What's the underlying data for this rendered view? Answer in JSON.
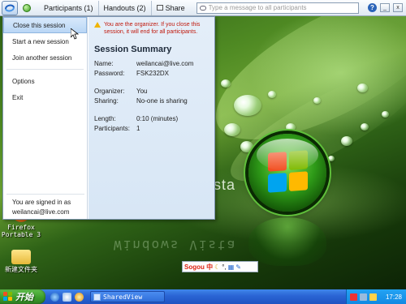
{
  "toolbar": {
    "participants_label": "Participants (1)",
    "handouts_label": "Handouts (2)",
    "share_label": "Share",
    "search_placeholder": "Type a message to all participants",
    "help_label": "?",
    "minimize_label": "_",
    "close_label": "x"
  },
  "menu": {
    "items": [
      {
        "label": "Close this session"
      },
      {
        "label": "Start a new session"
      },
      {
        "label": "Join another session"
      },
      {
        "label": "Options"
      },
      {
        "label": "Exit"
      }
    ],
    "signed_in_line1": "You are signed in as",
    "signed_in_line2": "weilancai@live.com"
  },
  "summary": {
    "warning": "You are the organizer. If you close this session, it will end for all participants.",
    "title": "Session Summary",
    "name_label": "Name:",
    "name_value": "weilancai@live.com",
    "password_label": "Password:",
    "password_value": "FSK232DX",
    "organizer_label": "Organizer:",
    "organizer_value": "You",
    "sharing_label": "Sharing:",
    "sharing_value": "No-one is sharing",
    "length_label": "Length:",
    "length_value": "0:10 (minutes)",
    "participants_label": "Participants:",
    "participants_value": "1"
  },
  "desktop": {
    "wallpaper_text": "sta",
    "reflection_text": "Windows Vista",
    "icons": [
      {
        "label_line1": "Firefox",
        "label_line2": "Portable 3"
      },
      {
        "label_line1": "新建文件夹",
        "label_line2": ""
      }
    ],
    "language_bar": "Sogou 中"
  },
  "taskbar": {
    "start_label": "开始",
    "window_button": "SharedView",
    "clock": "17:28"
  },
  "colors": {
    "menu_highlight": "#b9d6f5",
    "warning_text": "#c0180c",
    "taskbar_blue": "#2a64d4",
    "start_green": "#3a9a2a"
  }
}
